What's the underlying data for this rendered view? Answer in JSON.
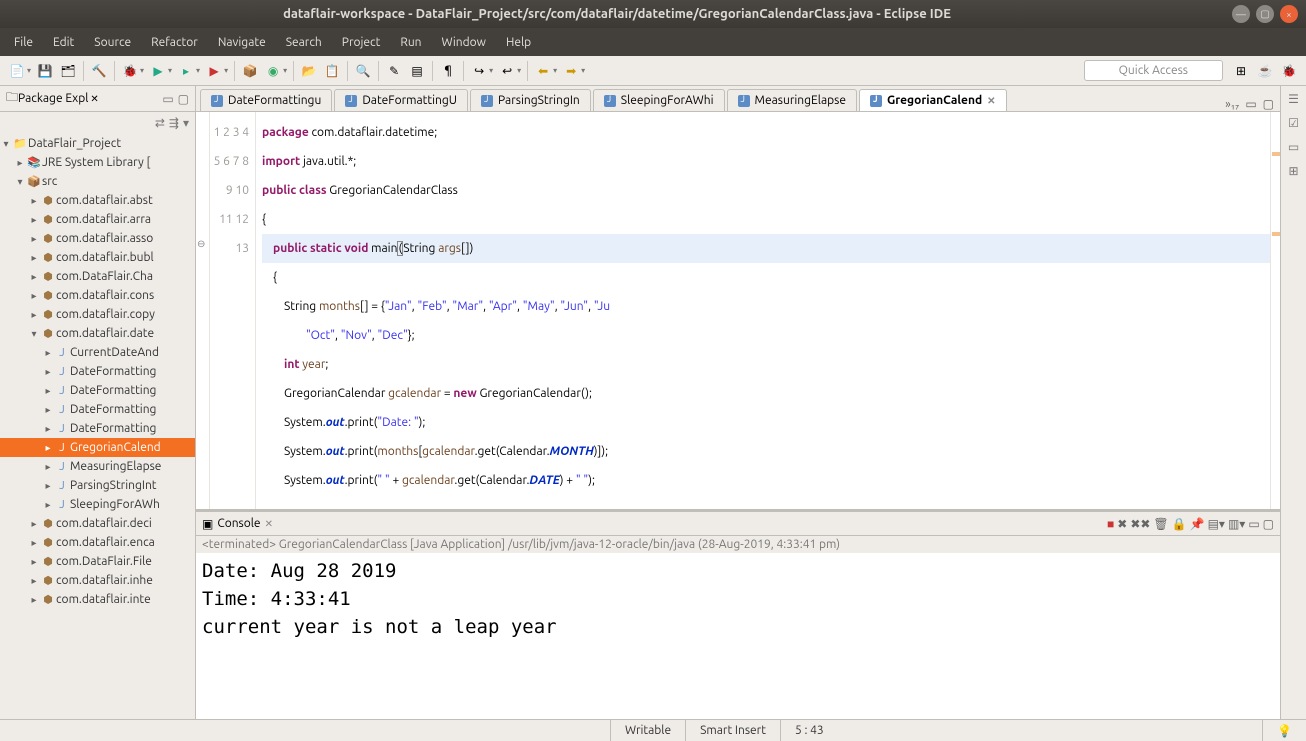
{
  "window": {
    "title": "dataflair-workspace - DataFlair_Project/src/com/dataflair/datetime/GregorianCalendarClass.java - Eclipse IDE"
  },
  "menu": [
    "File",
    "Edit",
    "Source",
    "Refactor",
    "Navigate",
    "Search",
    "Project",
    "Run",
    "Window",
    "Help"
  ],
  "quick_access": "Quick Access",
  "package_explorer": {
    "title": "Package Expl",
    "project": "DataFlair_Project",
    "jre": "JRE System Library [",
    "src": "src",
    "packages": [
      "com.dataflair.abst",
      "com.dataflair.arra",
      "com.dataflair.asso",
      "com.dataflair.bubl",
      "com.DataFlair.Cha",
      "com.dataflair.cons",
      "com.dataflair.copy"
    ],
    "open_pkg": "com.dataflair.date",
    "files": [
      "CurrentDateAnd",
      "DateFormatting",
      "DateFormatting",
      "DateFormatting",
      "DateFormatting"
    ],
    "selected_file": "GregorianCalend",
    "files_after": [
      "MeasuringElapse",
      "ParsingStringInt",
      "SleepingForAWh"
    ],
    "packages_after": [
      "com.dataflair.deci",
      "com.dataflair.enca",
      "com.DataFlair.File",
      "com.dataflair.inhe",
      "com.dataflair.inte"
    ]
  },
  "editor_tabs": [
    "DateFormattingu",
    "DateFormattingU",
    "ParsingStringIn",
    "SleepingForAWhi",
    "MeasuringElapse"
  ],
  "active_tab": "GregorianCalend",
  "tab_overflow": "»₁₇",
  "code": {
    "l1": {
      "kw": "package",
      "rest": " com.dataflair.datetime;"
    },
    "l2": {
      "kw": "import",
      "rest": " java.util.*;"
    },
    "l3a": "public",
    "l3b": "class",
    "l3c": " GregorianCalendarClass",
    "l4": "{",
    "l5a": "public",
    "l5b": "static",
    "l5c": "void",
    "l5d": " main",
    "l5e": "(",
    "l5f": "String ",
    "l5g": "args",
    "l5h": "[])",
    "l6": "    {",
    "l7a": "        String ",
    "l7b": "months",
    "l7c": "[] = {",
    "l7d": "\"Jan\"",
    "l7e": ", ",
    "l7f": "\"Feb\"",
    "l7g": "\"Mar\"",
    "l7h": "\"Apr\"",
    "l7i": "\"May\"",
    "l7j": "\"Jun\"",
    "l7k": "\"Ju",
    "l8a": "                ",
    "l8b": "\"Oct\"",
    "l8c": "\"Nov\"",
    "l8d": "\"Dec\"",
    "l8e": "};",
    "l9a": "int",
    "l9b": "year",
    "l10a": "        GregorianCalendar ",
    "l10b": "gcalendar",
    "l10c": " = ",
    "l10d": "new",
    "l10e": " GregorianCalendar();",
    "l11a": "        System.",
    "l11b": "out",
    "l11c": ".print(",
    "l11d": "\"Date: \"",
    "l11e": ");",
    "l12a": "        System.",
    "l12b": "out",
    "l12c": ".print(",
    "l12d": "months",
    "l12e": "[",
    "l12f": "gcalendar",
    "l12g": ".get(Calendar.",
    "l12h": "MONTH",
    "l12i": ")]);",
    "l13a": "        System.",
    "l13b": "out",
    "l13c": ".print(",
    "l13d": "\" \"",
    "l13e": " + ",
    "l13f": "gcalendar",
    "l13g": ".get(Calendar.",
    "l13h": "DATE",
    "l13i": ") + ",
    "l13j": "\" \"",
    "l13k": ");"
  },
  "line_numbers": [
    "1",
    "2",
    "3",
    "4",
    "5",
    "6",
    "7",
    "8",
    "9",
    "10",
    "11",
    "12",
    "13"
  ],
  "console": {
    "title": "Console",
    "info": "<terminated> GregorianCalendarClass [Java Application] /usr/lib/jvm/java-12-oracle/bin/java (28-Aug-2019, 4:33:41 pm)",
    "output": "Date: Aug 28 2019\nTime: 4:33:41\ncurrent year is not a leap year"
  },
  "status": {
    "writable": "Writable",
    "insert": "Smart Insert",
    "pos": "5 : 43"
  }
}
